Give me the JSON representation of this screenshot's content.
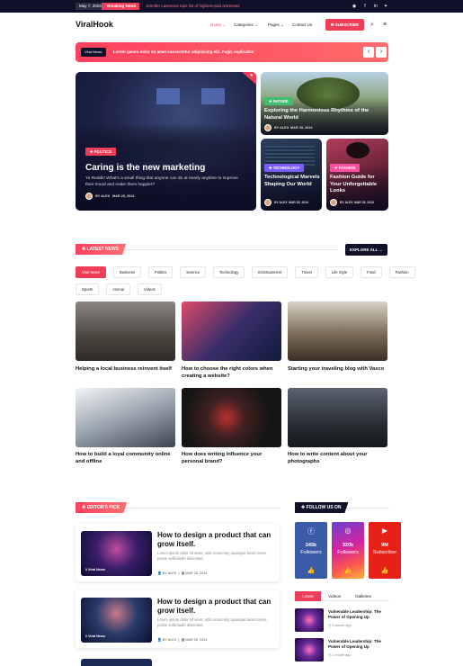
{
  "topbar": {
    "date": "May 7, 2024",
    "breaking_label": "Breaking News",
    "ticker": "Jennifer Lawrence tops list of highest-paid actresses"
  },
  "header": {
    "logo": "ViralHook",
    "nav": [
      {
        "label": "Home",
        "arrow": "⌄",
        "active": true
      },
      {
        "label": "Categories",
        "arrow": "⌄"
      },
      {
        "label": "Pages",
        "arrow": "⌄"
      },
      {
        "label": "Contact Us",
        "arrow": ""
      }
    ],
    "subscribe": "SUBSCRIBE"
  },
  "newsbar": {
    "tag": "Viral News:",
    "text": "Lorem ipsum dolor sit amet consectetur adipisicing elit. Fugit, explicabo!"
  },
  "hero": {
    "main": {
      "badge": "POLITICS",
      "title": "Caring is the new marketing",
      "excerpt": "Yo Reddit! What's a small thing that anyone can do at nearly anytime to improve their mood and make them happier?",
      "author": "BY ALEX",
      "date": "MAR 25, 2024"
    },
    "nature": {
      "badge": "NATURE",
      "title": "Exploring the Harmonious Rhythms of the Natural World",
      "author": "BY ALEX",
      "date": "MAR 25, 2024"
    },
    "tech": {
      "badge": "TECHNOLOGY",
      "title": "Technological Marvels Shaping Our World",
      "author": "BY ALEX",
      "date": "MAR 25, 2024"
    },
    "fashion": {
      "badge": "FASHION",
      "title": "Fashion Guide for Your Unforgettable Looks",
      "author": "BY ALEX",
      "date": "MAR 25, 2024"
    }
  },
  "latest": {
    "heading": "LATEST NEWS",
    "explore": "EXPLORE ALL",
    "filters_row1": [
      "Viral News",
      "Business",
      "Politics",
      "Science",
      "Technology",
      "Entertainment",
      "Travel",
      "Life Style",
      "Food",
      "Fashion"
    ],
    "filters_row2": [
      "Sports",
      "Animal",
      "Videos"
    ],
    "articles": [
      {
        "title": "Helping a local business reinvent itself"
      },
      {
        "title": "How to choose the right colors when creating a website?"
      },
      {
        "title": "Starting your traveling blog with Vasco"
      },
      {
        "title": "How to build a loyal community online and offline"
      },
      {
        "title": "How does writing influence your personal brand?"
      },
      {
        "title": "How to write content about your photographs"
      }
    ]
  },
  "editors_pick": {
    "heading": "EDITOR'S PICK",
    "items": [
      {
        "title": "How to design a product that can grow itself.",
        "desc": "Lorem ipsum dolor sit amet, odio nonummy quaisque lacus lorem, posse sollicitudin dissentiet.",
        "label": "Viral News",
        "author": "BY ALEX",
        "date": "MAR 25, 2024"
      },
      {
        "title": "How to design a product that can grow itself.",
        "desc": "Lorem ipsum dolor sit amet, odio nonummy quaisque lacus lorem, posse sollicitudin dissentiet.",
        "label": "Viral News",
        "author": "BY ALEX",
        "date": "MAR 25, 2024"
      }
    ]
  },
  "follow": {
    "heading": "FOLLOW US ON",
    "networks": [
      {
        "count": "245k",
        "label": "Followers",
        "color": "#3b5ba8"
      },
      {
        "count": "320k",
        "label": "Followers",
        "color": "#d6249f"
      },
      {
        "count": "9M",
        "label": "Subscriber",
        "color": "#e62117"
      }
    ]
  },
  "sidebar_tabs": {
    "tabs": [
      "Latest",
      "Videos",
      "Galleries"
    ],
    "items": [
      {
        "title": "Vulnerable Leadership: The Power of Opening Up",
        "time": "3 weeks ago"
      },
      {
        "title": "Vulnerable Leadership: The Power of Opening Up",
        "time": "1 month ago"
      }
    ]
  },
  "colors": {
    "accent": "#ef3e59",
    "dark": "#101029"
  }
}
